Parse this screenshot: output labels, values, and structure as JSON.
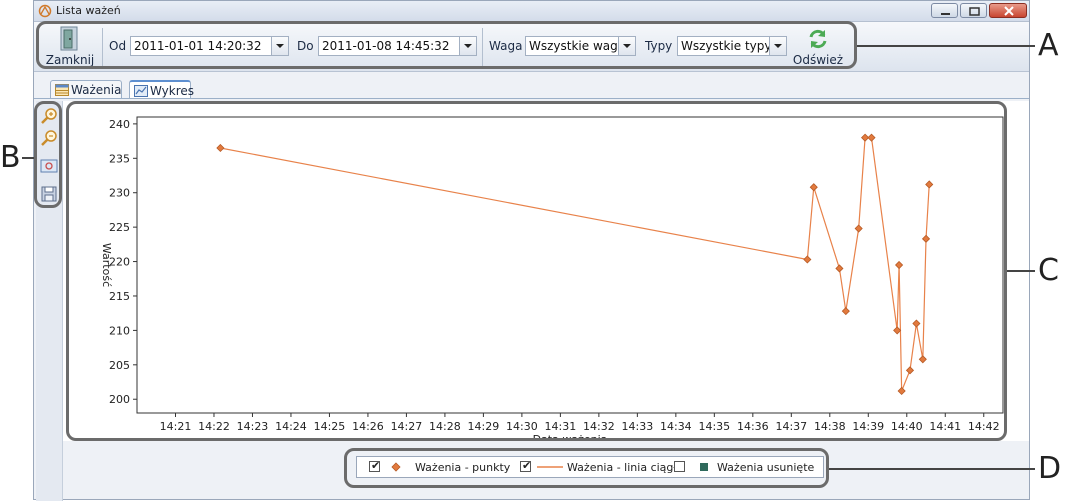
{
  "window": {
    "title": "Lista ważeń"
  },
  "toolbar": {
    "close_label": "Zamknij",
    "from_label": "Od",
    "from_value": "2011-01-01 14:20:32",
    "to_label": "Do",
    "to_value": "2011-01-08 14:45:32",
    "scale_label": "Waga",
    "scale_value": "Wszystkie wagi",
    "types_label": "Typy",
    "types_value": "Wszystkie typy",
    "refresh_label": "Odśwież"
  },
  "tabs": [
    {
      "label": "Ważenia",
      "active": false
    },
    {
      "label": "Wykres",
      "active": true
    }
  ],
  "side_tools": [
    "zoom-in-icon",
    "zoom-out-icon",
    "fit-view-icon",
    "save-icon"
  ],
  "callouts": {
    "a": "A",
    "b": "B",
    "c": "C",
    "d": "D"
  },
  "legend": {
    "points_label": "Ważenia - punkty",
    "points_checked": true,
    "line_label": "Ważenia - linia ciągła",
    "line_checked": true,
    "deleted_label": "Ważenia usunięte",
    "deleted_checked": false
  },
  "colors": {
    "series": "#e8824a",
    "point_fill": "#e27a3e",
    "point_stroke": "#b65a25",
    "deleted": "#2f6a5c"
  },
  "chart_data": {
    "type": "line",
    "xlabel": "Data ważenia",
    "ylabel": "Wartość",
    "ylim": [
      198,
      241
    ],
    "yticks": [
      200,
      205,
      210,
      215,
      220,
      225,
      230,
      235,
      240
    ],
    "xticks": [
      "14:21",
      "14:22",
      "14:23",
      "14:24",
      "14:25",
      "14:26",
      "14:27",
      "14:28",
      "14:29",
      "14:30",
      "14:31",
      "14:32",
      "14:33",
      "14:34",
      "14:35",
      "14:36",
      "14:37",
      "14:38",
      "14:39",
      "14:40",
      "14:41",
      "14:42"
    ],
    "series": [
      {
        "name": "Ważenia - punkty",
        "x": [
          "14:22:10",
          "14:37:25",
          "14:37:35",
          "14:38:15",
          "14:38:25",
          "14:38:45",
          "14:38:55",
          "14:39:05",
          "14:39:45",
          "14:39:48",
          "14:39:52",
          "14:40:05",
          "14:40:15",
          "14:40:25",
          "14:40:30",
          "14:40:35"
        ],
        "values": [
          236.5,
          220.3,
          230.8,
          219.0,
          212.8,
          224.8,
          238.0,
          238.0,
          210.0,
          219.5,
          201.2,
          204.2,
          211.0,
          205.8,
          223.3,
          231.2
        ]
      }
    ],
    "grid": false,
    "legend_position": "bottom"
  }
}
